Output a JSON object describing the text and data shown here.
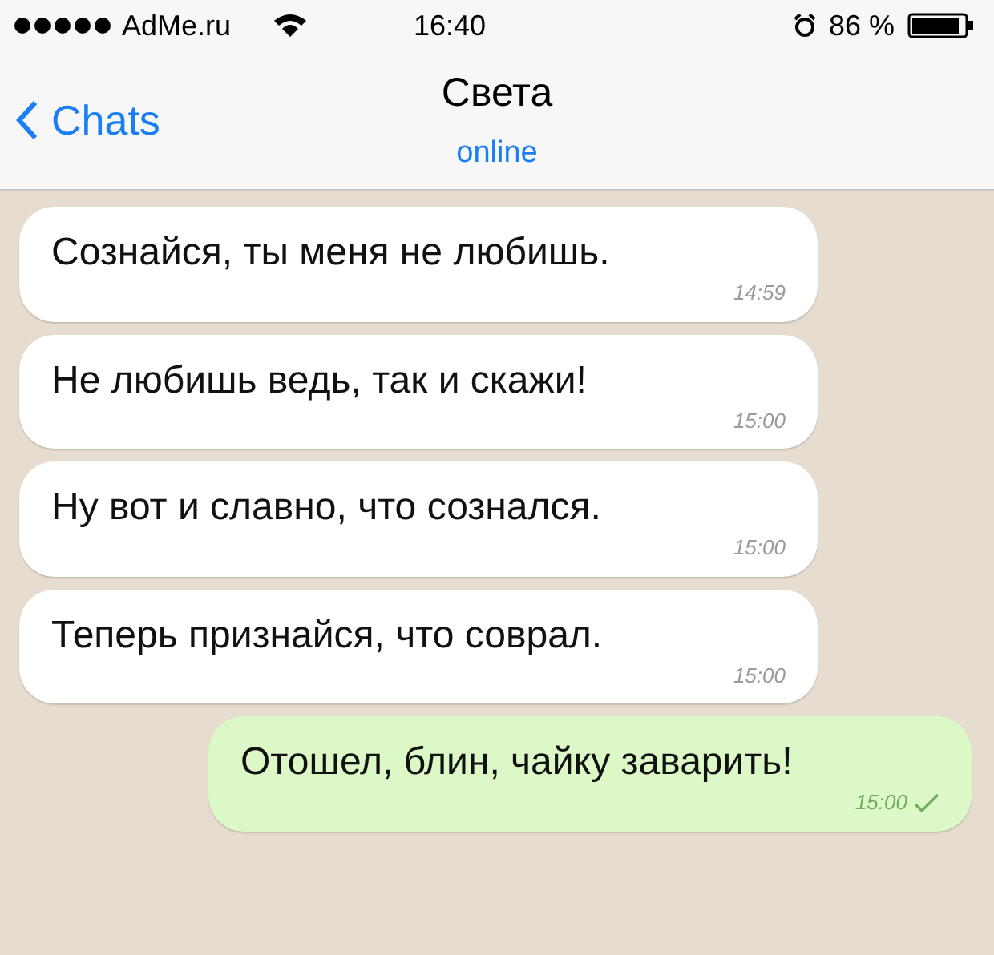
{
  "status_bar": {
    "carrier": "AdMe.ru",
    "time": "16:40",
    "battery": "86 %"
  },
  "header": {
    "back": "Chats",
    "title": "Света",
    "subtitle": "online"
  },
  "messages": [
    {
      "kind": "incoming",
      "text": "Сознайся, ты меня не любишь.",
      "time": "14:59"
    },
    {
      "kind": "incoming",
      "text": "Не любишь ведь, так и скажи!",
      "time": "15:00"
    },
    {
      "kind": "incoming",
      "text": "Ну вот и славно, что сознался.",
      "time": "15:00"
    },
    {
      "kind": "incoming",
      "text": "Теперь признайся, что соврал.",
      "time": "15:00"
    },
    {
      "kind": "outgoing",
      "text": "Отошел, блин, чайку заварить!",
      "time": "15:00",
      "delivered": true
    }
  ]
}
